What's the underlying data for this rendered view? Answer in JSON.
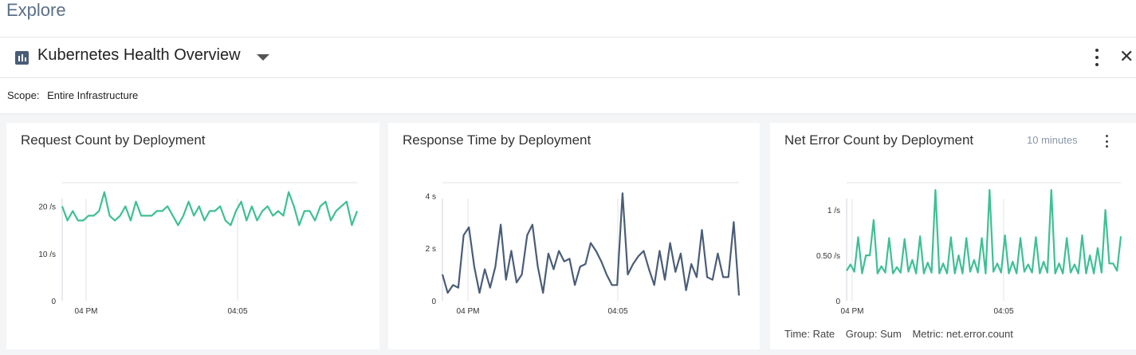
{
  "page": {
    "title": "Explore"
  },
  "dashboard": {
    "title": "Kubernetes Health Overview"
  },
  "scope": {
    "label": "Scope:",
    "value": "Entire Infrastructure"
  },
  "panels": [
    {
      "title": "Request Count by Deployment"
    },
    {
      "title": "Response Time by Deployment"
    },
    {
      "title": "Net Error Count by Deployment",
      "time_range": "10 minutes",
      "footer": {
        "time": "Time: Rate",
        "group": "Group: Sum",
        "metric": "Metric: net.error.count"
      }
    }
  ],
  "colors": {
    "teal": "#3fbf96",
    "slate": "#4a5d78",
    "title": "#5b6f88"
  },
  "chart_data": [
    {
      "type": "line",
      "title": "Request Count by Deployment",
      "x_ticks": [
        "04 PM",
        "04:05"
      ],
      "y_ticks": [
        "0",
        "10 /s",
        "20 /s"
      ],
      "ylim": [
        0,
        25
      ],
      "series": [
        {
          "color": "#3fbf96",
          "values": [
            20,
            17,
            19,
            17,
            17,
            18,
            18,
            19,
            23,
            18,
            17,
            18,
            20,
            17,
            21,
            18,
            18,
            18,
            19,
            19,
            20,
            18,
            16,
            18,
            21,
            18,
            20,
            17,
            19,
            19,
            20,
            17,
            16,
            19,
            21,
            17,
            20,
            17,
            19,
            20,
            18,
            19,
            18,
            23,
            20,
            16,
            19,
            19,
            17,
            20,
            21,
            17,
            19,
            20,
            21,
            16,
            19
          ]
        }
      ]
    },
    {
      "type": "line",
      "title": "Response Time by Deployment",
      "x_ticks": [
        "04 PM",
        "04:05"
      ],
      "y_ticks": [
        "0",
        "2 s",
        "4 s"
      ],
      "ylim": [
        0,
        4.5
      ],
      "series": [
        {
          "color": "#4a5d78",
          "values": [
            1.0,
            0.3,
            0.6,
            0.5,
            2.5,
            2.8,
            1.3,
            0.3,
            1.2,
            0.5,
            1.3,
            2.9,
            0.8,
            1.9,
            0.7,
            1.0,
            2.5,
            2.9,
            1.3,
            0.3,
            1.8,
            1.2,
            1.9,
            1.5,
            1.6,
            0.6,
            1.3,
            1.4,
            2.2,
            1.9,
            1.5,
            1.0,
            0.6,
            0.6,
            4.1,
            1.0,
            1.4,
            1.7,
            1.9,
            1.2,
            0.6,
            1.9,
            0.8,
            2.2,
            1.1,
            1.8,
            0.4,
            1.4,
            0.9,
            2.7,
            0.9,
            0.8,
            1.8,
            0.9,
            0.9,
            3.0,
            0.2
          ]
        }
      ]
    },
    {
      "type": "line",
      "title": "Net Error Count by Deployment",
      "x_ticks": [
        "04 PM",
        "04:05"
      ],
      "y_ticks": [
        "0",
        "0.50 /s",
        "1 /s"
      ],
      "ylim": [
        0,
        1.3
      ],
      "series": [
        {
          "color": "#3fbf96",
          "values": [
            0.33,
            0.4,
            0.32,
            0.7,
            0.3,
            0.5,
            0.5,
            0.89,
            0.3,
            0.38,
            0.31,
            0.69,
            0.3,
            0.37,
            0.31,
            0.68,
            0.32,
            0.45,
            0.3,
            0.71,
            0.3,
            0.42,
            0.31,
            1.22,
            0.3,
            0.41,
            0.3,
            0.7,
            0.3,
            0.5,
            0.3,
            0.69,
            0.32,
            0.45,
            0.31,
            0.69,
            0.3,
            1.22,
            0.32,
            0.41,
            0.31,
            0.72,
            0.3,
            0.43,
            0.3,
            0.69,
            0.32,
            0.4,
            0.31,
            0.7,
            0.3,
            0.43,
            0.31,
            1.22,
            0.3,
            0.41,
            0.3,
            0.69,
            0.31,
            0.4,
            0.3,
            0.72,
            0.3,
            0.5,
            0.3,
            0.58,
            0.31,
            1.0,
            0.41,
            0.41,
            0.33,
            0.71
          ]
        }
      ]
    }
  ]
}
